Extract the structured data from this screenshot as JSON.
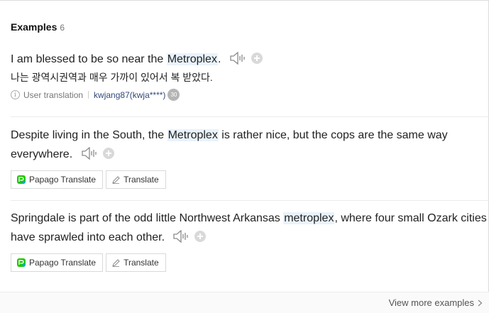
{
  "section": {
    "title": "Examples",
    "count": "6"
  },
  "examples": [
    {
      "before": "I am blessed to be so near the ",
      "highlight": "Metroplex",
      "after": ".",
      "translation": "나는 광역시권역과 매우 가까이 있어서 복 받았다.",
      "meta": {
        "source": "User translation",
        "user": "kwjang87(kwja****)",
        "badge": "30"
      }
    },
    {
      "before": "Despite living in the South, the ",
      "highlight": "Metroplex",
      "after": " is rather nice, but the cops are the same way everywhere.",
      "buttons": {
        "papago": "Papago Translate",
        "translate": "Translate"
      }
    },
    {
      "before": "Springdale is part of the odd little Northwest Arkansas ",
      "highlight": "metroplex",
      "after": ", where four small Ozark cities have sprawled into each other.",
      "buttons": {
        "papago": "Papago Translate",
        "translate": "Translate"
      }
    }
  ],
  "footer": {
    "view_more": "View more examples"
  },
  "colors": {
    "highlight": "#e9f3fc",
    "papago_green": "#1ec800",
    "papago_blue": "#0aa6e8"
  },
  "icons": [
    "speaker-icon",
    "plus-icon",
    "info-icon",
    "papago-icon",
    "pencil-icon",
    "chevron-right-icon"
  ]
}
